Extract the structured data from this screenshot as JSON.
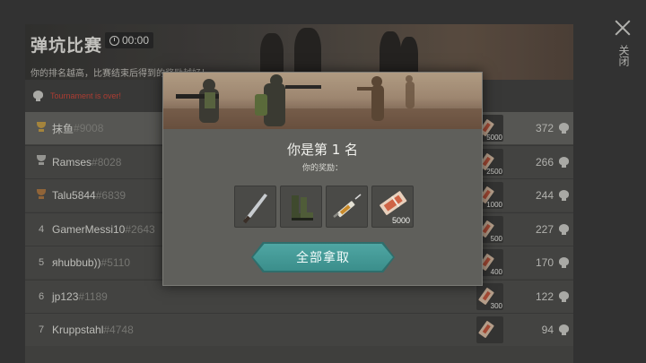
{
  "header": {
    "title": "弹坑比赛",
    "timer": "00:00",
    "subtitle": "你的排名越高，比赛结束后得到的奖励越好！",
    "status": "Tournament is over!"
  },
  "close": {
    "label": "关闭"
  },
  "leaderboard": [
    {
      "rank": "",
      "trophy": "gold",
      "name": "抹鱼",
      "tag": "#9008",
      "reward": "5000",
      "score": "372"
    },
    {
      "rank": "",
      "trophy": "silver",
      "name": "Ramses",
      "tag": "#8028",
      "reward": "2500",
      "score": "266"
    },
    {
      "rank": "",
      "trophy": "bronze",
      "name": "Talu5844",
      "tag": "#6839",
      "reward": "1000",
      "score": "244"
    },
    {
      "rank": "4",
      "trophy": "",
      "name": "GamerMessi10",
      "tag": "#2643",
      "reward": "500",
      "score": "227"
    },
    {
      "rank": "5",
      "trophy": "",
      "name": "яhubbub))",
      "tag": "#5110",
      "reward": "400",
      "score": "170"
    },
    {
      "rank": "6",
      "trophy": "",
      "name": "jp123",
      "tag": "#1189",
      "reward": "300",
      "score": "122"
    },
    {
      "rank": "7",
      "trophy": "",
      "name": "Kruppstahl",
      "tag": "#4748",
      "reward": "",
      "score": "94"
    }
  ],
  "modal": {
    "title": "你是第 1 名",
    "subtitle": "你的奖励：",
    "rewards": [
      {
        "icon": "machete-icon",
        "amount": ""
      },
      {
        "icon": "boots-icon",
        "amount": ""
      },
      {
        "icon": "syringe-icon",
        "amount": ""
      },
      {
        "icon": "coupon-icon",
        "amount": "5000"
      }
    ],
    "claim_label": "全部拿取"
  }
}
